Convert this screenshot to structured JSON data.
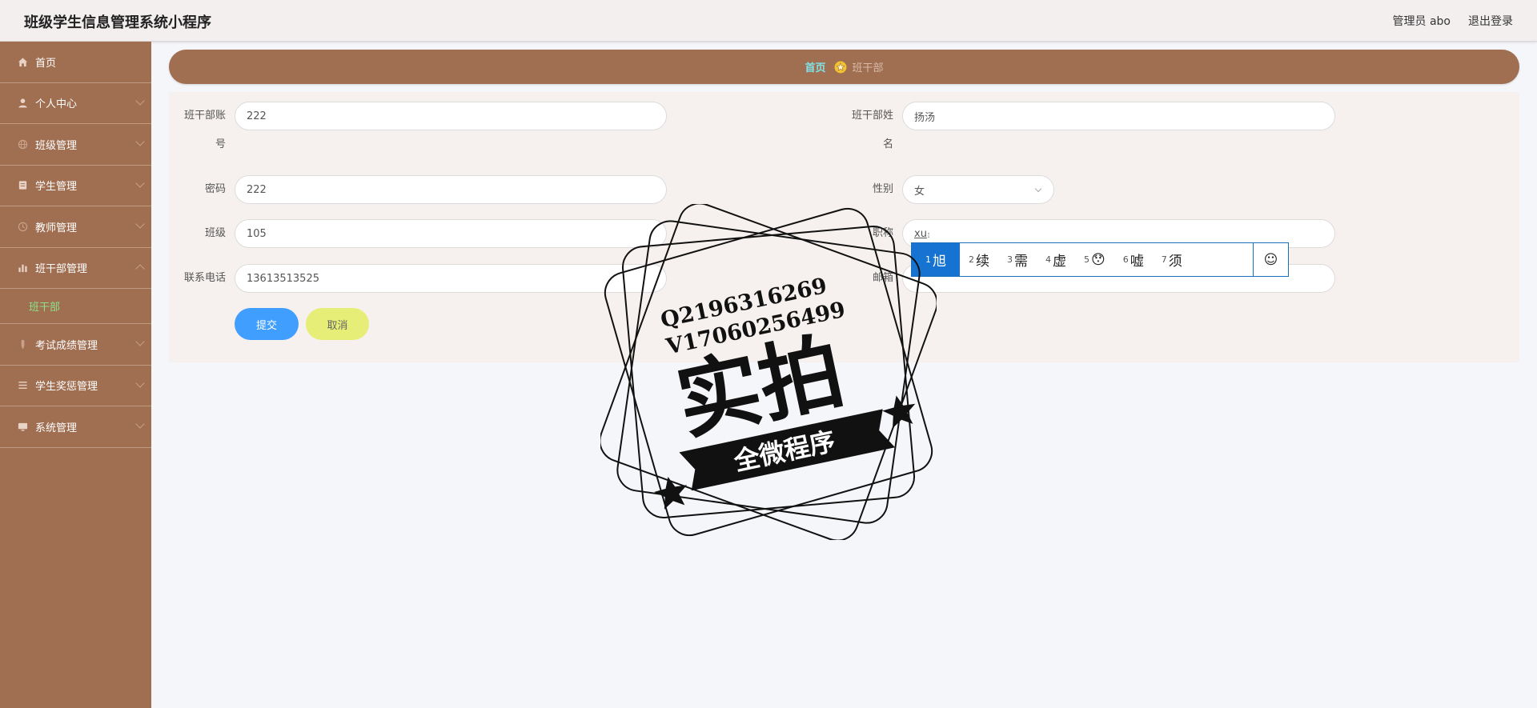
{
  "header": {
    "title": "班级学生信息管理系统小程序",
    "user_label": "管理员 abo",
    "logout_label": "退出登录"
  },
  "sidebar": {
    "items": [
      {
        "label": "首页",
        "icon": "home-icon"
      },
      {
        "label": "个人中心",
        "icon": "user-icon"
      },
      {
        "label": "班级管理",
        "icon": "globe-icon"
      },
      {
        "label": "学生管理",
        "icon": "book-icon"
      },
      {
        "label": "教师管理",
        "icon": "clock-icon"
      },
      {
        "label": "班干部管理",
        "icon": "chart-icon"
      },
      {
        "label": "考试成绩管理",
        "icon": "pen-icon"
      },
      {
        "label": "学生奖惩管理",
        "icon": "list-icon"
      },
      {
        "label": "系统管理",
        "icon": "monitor-icon"
      }
    ],
    "submenu": {
      "label": "班干部"
    }
  },
  "breadcrumb": {
    "home": "首页",
    "current": "班干部"
  },
  "form": {
    "account_label": "班干部账号",
    "account_value": "222",
    "name_label": "班干部姓名",
    "name_value": "扬汤",
    "password_label": "密码",
    "password_value": "222",
    "gender_label": "性别",
    "gender_value": "女",
    "class_label": "班级",
    "class_value": "105",
    "position_label": "职称",
    "position_value": "xu",
    "phone_label": "联系电话",
    "phone_value": "13613513525",
    "email_label": "邮箱",
    "email_value": "",
    "submit_label": "提交",
    "cancel_label": "取消"
  },
  "ime": {
    "candidates": [
      {
        "num": "1",
        "text": "旭"
      },
      {
        "num": "2",
        "text": "续"
      },
      {
        "num": "3",
        "text": "需"
      },
      {
        "num": "4",
        "text": "虚"
      },
      {
        "num": "5",
        "text": "😯"
      },
      {
        "num": "6",
        "text": "嘘"
      },
      {
        "num": "7",
        "text": "须"
      }
    ],
    "emoji_button": "☺"
  },
  "watermark": {
    "line1": "Q2196316269",
    "line2": "V17060256499",
    "main": "实拍",
    "sub": "全微程序"
  },
  "colors": {
    "sidebar": "#a06e51",
    "accent_home": "#7fe3e8",
    "submit": "#409eff",
    "cancel": "#e6ee77",
    "submenu_text": "#8de28a"
  }
}
